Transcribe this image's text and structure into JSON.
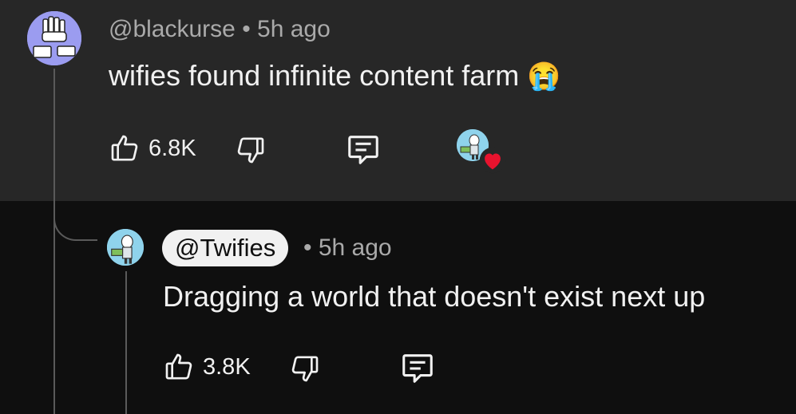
{
  "comment": {
    "author": "@blackurse",
    "time": "• 5h ago",
    "text": "wifies found infinite content farm",
    "emoji": "😭",
    "likes": "6.8K"
  },
  "reply": {
    "author": "@Twifies",
    "time": "• 5h ago",
    "text": "Dragging a world that doesn't exist next up",
    "likes": "3.8K"
  },
  "icons": {
    "like": "thumbs-up-icon",
    "dislike": "thumbs-down-icon",
    "reply": "comment-icon",
    "creator_heart": "heart-icon"
  },
  "colors": {
    "top_bg": "#272727",
    "bottom_bg": "#0f0f0f",
    "heart": "#e8132e",
    "chip": "#f1f1f1"
  }
}
